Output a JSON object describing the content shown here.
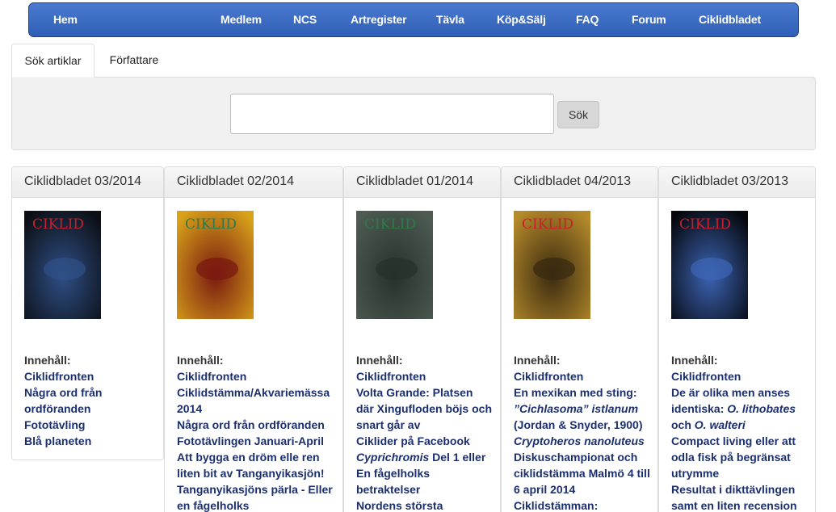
{
  "nav": {
    "items": [
      "Hem",
      "Medlem",
      "NCS",
      "Artregister",
      "Tävla",
      "Köp&Sälj",
      "FAQ",
      "Forum",
      "Ciklidbladet"
    ]
  },
  "tabs": {
    "active": "Sök artiklar",
    "inactive": "Författare"
  },
  "search": {
    "value": "",
    "button_label": "Sök"
  },
  "contents_label": "Innehåll:",
  "issues": [
    {
      "title": "Ciklidbladet 03/2014",
      "cover_colors": [
        "#0b0f14",
        "#2f4f86"
      ],
      "articles": [
        {
          "parts": [
            {
              "t": "Ciklidfronten",
              "i": false
            }
          ]
        },
        {
          "parts": [
            {
              "t": "Några ord från ordföranden",
              "i": false
            }
          ]
        },
        {
          "parts": [
            {
              "t": "Fototävling",
              "i": false
            }
          ]
        },
        {
          "parts": [
            {
              "t": "Blå planeten",
              "i": false
            }
          ]
        }
      ]
    },
    {
      "title": "Ciklidbladet 02/2014",
      "cover_colors": [
        "#d8a21a",
        "#7a1a10"
      ],
      "articles": [
        {
          "parts": [
            {
              "t": "Ciklidfronten",
              "i": false
            }
          ]
        },
        {
          "parts": [
            {
              "t": "Ciklidstämma/Akvariemässa 2014",
              "i": false
            }
          ]
        },
        {
          "parts": [
            {
              "t": "Några ord från ordföranden",
              "i": false
            }
          ]
        },
        {
          "parts": [
            {
              "t": "Fototävlingen Januari-April",
              "i": false
            }
          ]
        },
        {
          "parts": [
            {
              "t": "Att bygga en dröm elle ren liten bit av Tanganyikasjön!",
              "i": false
            }
          ]
        },
        {
          "parts": [
            {
              "t": "Tanganyikasjöns pärla - Eller en fågelholks",
              "i": false
            }
          ]
        }
      ]
    },
    {
      "title": "Ciklidbladet 01/2014",
      "cover_colors": [
        "#4d5b52",
        "#27312b"
      ],
      "articles": [
        {
          "parts": [
            {
              "t": "Ciklidfronten",
              "i": false
            }
          ]
        },
        {
          "parts": [
            {
              "t": "Volta Grande: Platsen där Xingufloden böjs och snart går av",
              "i": false
            }
          ]
        },
        {
          "parts": [
            {
              "t": "Ciklider på Facebook",
              "i": false
            }
          ]
        },
        {
          "parts": [
            {
              "t": "Cyprichromis",
              "i": true
            },
            {
              "t": " Del 1 eller En fågelholks betraktelser",
              "i": false
            }
          ]
        },
        {
          "parts": [
            {
              "t": "Nordens största",
              "i": false
            }
          ]
        }
      ]
    },
    {
      "title": "Ciklidbladet 04/2013",
      "cover_colors": [
        "#b58a2a",
        "#3a2a10"
      ],
      "articles": [
        {
          "parts": [
            {
              "t": "Ciklidfronten",
              "i": false
            }
          ]
        },
        {
          "parts": [
            {
              "t": "En mexikan med sting: ",
              "i": false
            },
            {
              "t": "”Cichlasoma” istlanum",
              "i": true
            },
            {
              "t": " (Jordan & Snyder, 1900)",
              "i": false
            }
          ]
        },
        {
          "parts": [
            {
              "t": "Cryptoheros nanoluteus",
              "i": true
            }
          ]
        },
        {
          "parts": [
            {
              "t": "Diskuschampionat och ciklidstämma Malmö 4 till 6 april 2014",
              "i": false
            }
          ]
        },
        {
          "parts": [
            {
              "t": "Ciklidstämman:",
              "i": false
            }
          ]
        }
      ]
    },
    {
      "title": "Ciklidbladet 03/2013",
      "cover_colors": [
        "#05070c",
        "#3c64b4"
      ],
      "articles": [
        {
          "parts": [
            {
              "t": "Ciklidfronten",
              "i": false
            }
          ]
        },
        {
          "parts": [
            {
              "t": "De är olika men anses identiska: ",
              "i": false
            },
            {
              "t": "O. lithobates",
              "i": true
            },
            {
              "t": " och ",
              "i": false
            },
            {
              "t": "O. walteri",
              "i": true
            }
          ]
        },
        {
          "parts": [
            {
              "t": "Compact living eller att odla fisk på begränsat utrymme",
              "i": false
            }
          ]
        },
        {
          "parts": [
            {
              "t": "Resultat i dikttävlingen samt en liten recension",
              "i": false
            }
          ]
        }
      ]
    }
  ],
  "cover_logo": "CIKLID"
}
